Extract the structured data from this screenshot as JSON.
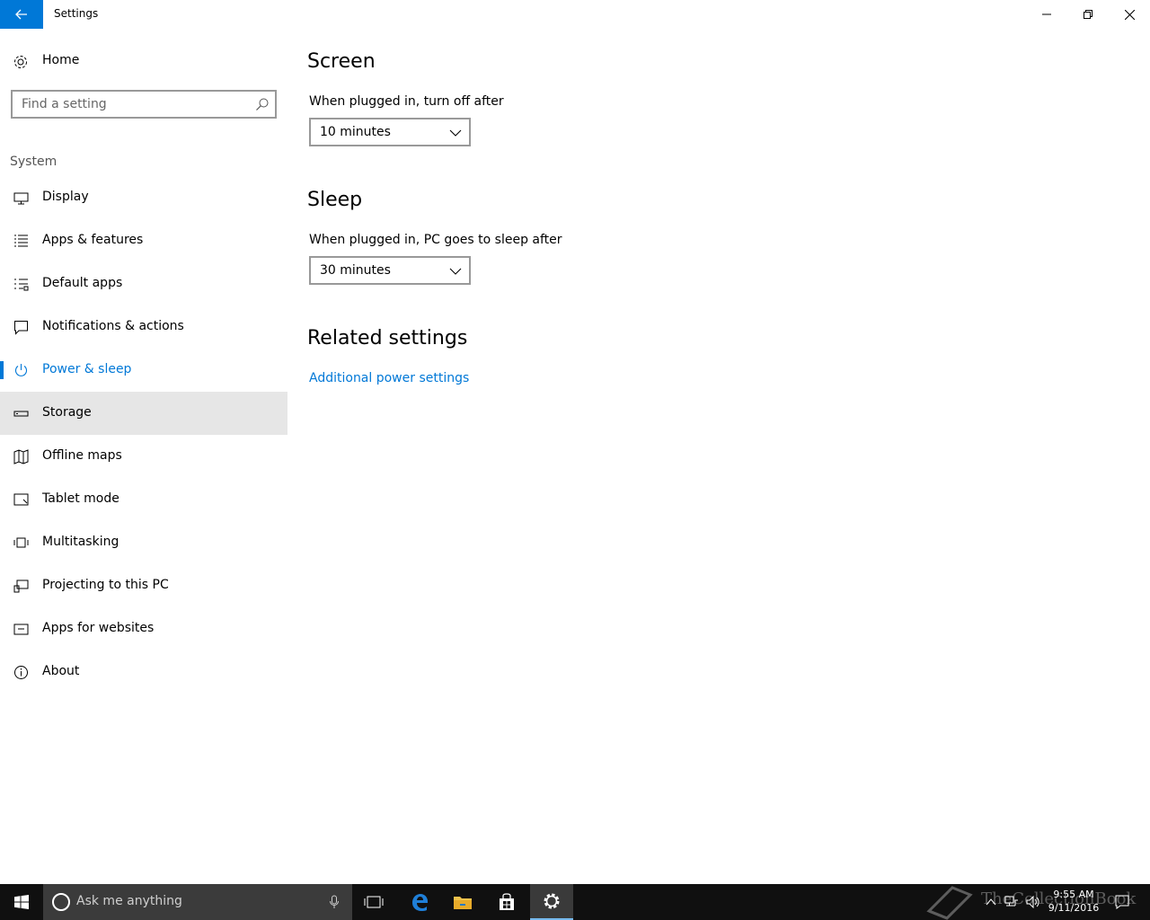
{
  "window": {
    "title": "Settings"
  },
  "sidebar": {
    "home_label": "Home",
    "search_placeholder": "Find a setting",
    "group_label": "System",
    "items": [
      {
        "label": "Display",
        "icon": "monitor-icon"
      },
      {
        "label": "Apps & features",
        "icon": "list-icon"
      },
      {
        "label": "Default apps",
        "icon": "default-apps-icon"
      },
      {
        "label": "Notifications & actions",
        "icon": "message-icon"
      },
      {
        "label": "Power & sleep",
        "icon": "power-icon",
        "active": true
      },
      {
        "label": "Storage",
        "icon": "storage-icon",
        "hover": true
      },
      {
        "label": "Offline maps",
        "icon": "map-icon"
      },
      {
        "label": "Tablet mode",
        "icon": "tablet-icon"
      },
      {
        "label": "Multitasking",
        "icon": "multitasking-icon"
      },
      {
        "label": "Projecting to this PC",
        "icon": "projecting-icon"
      },
      {
        "label": "Apps for websites",
        "icon": "apps-websites-icon"
      },
      {
        "label": "About",
        "icon": "info-icon"
      }
    ]
  },
  "content": {
    "screen": {
      "heading": "Screen",
      "label": "When plugged in, turn off after",
      "value": "10 minutes"
    },
    "sleep": {
      "heading": "Sleep",
      "label": "When plugged in, PC goes to sleep after",
      "value": "30 minutes"
    },
    "related": {
      "heading": "Related settings",
      "link": "Additional power settings"
    }
  },
  "taskbar": {
    "search_placeholder": "Ask me anything",
    "time": "9:55 AM",
    "date": "9/11/2016",
    "watermark": "TheCollectionBook"
  },
  "colors": {
    "accent": "#0078d7",
    "taskbar": "#101010",
    "hover": "#e6e6e6"
  }
}
